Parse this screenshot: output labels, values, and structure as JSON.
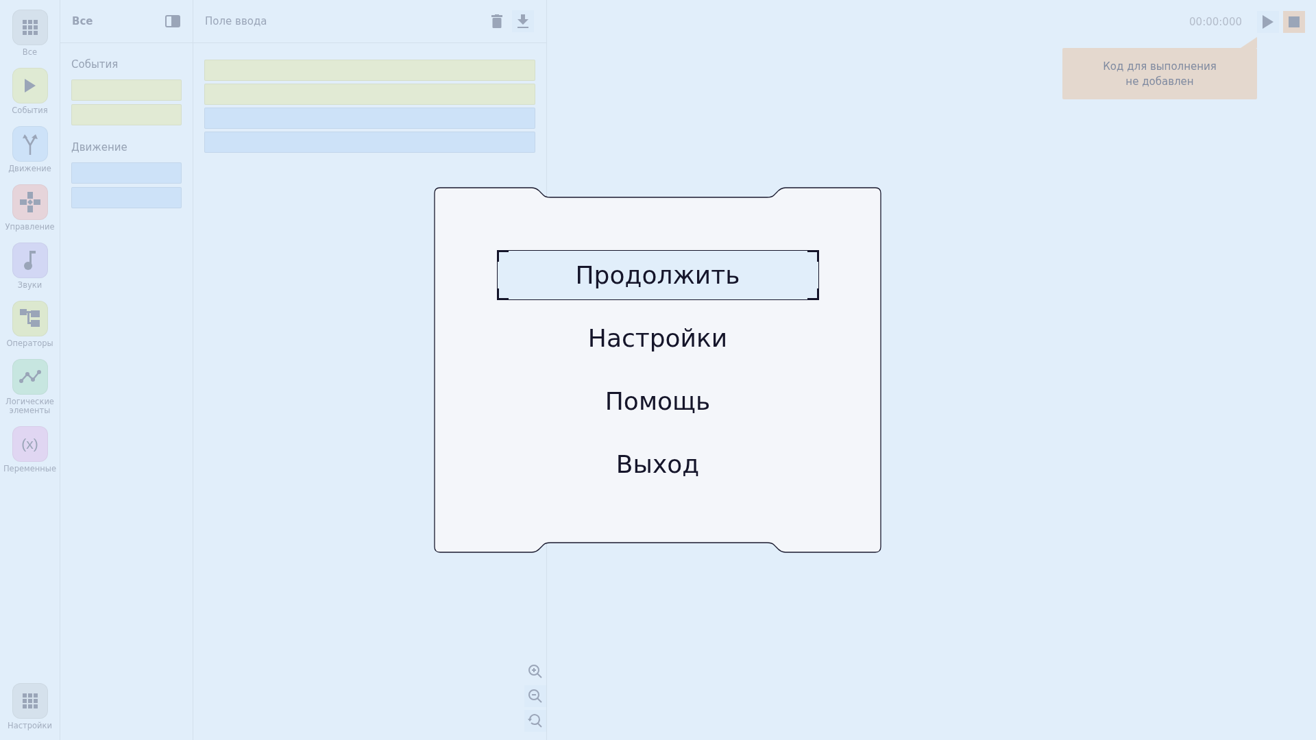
{
  "rail": {
    "items": [
      {
        "label": "Все",
        "color": "#d5e1ec"
      },
      {
        "label": "События",
        "color": "#dfead3"
      },
      {
        "label": "Движение",
        "color": "#cde2f8"
      },
      {
        "label": "Управление",
        "color": "#e6d4da"
      },
      {
        "label": "Звуки",
        "color": "#d2d7f4"
      },
      {
        "label": "Операторы",
        "color": "#dce8cf"
      },
      {
        "label": "Логические элементы",
        "color": "#c7e6e0"
      },
      {
        "label": "Переменные",
        "glyph": "(x)",
        "color": "#e0d6f2"
      }
    ],
    "bottom": {
      "label": "Настройки",
      "color": "#d5e1ec"
    }
  },
  "palette": {
    "title": "Все",
    "sections": [
      {
        "title": "События",
        "blocks": [
          {
            "color": "#e1ead4"
          },
          {
            "color": "#e1ead4"
          }
        ]
      },
      {
        "title": "Движение",
        "blocks": [
          {
            "color": "#cde2f8"
          },
          {
            "color": "#cde2f8"
          }
        ]
      }
    ]
  },
  "workspace": {
    "title": "Поле ввода",
    "blocks": [
      {
        "color": "#e1ead4"
      },
      {
        "color": "#e1ead4"
      },
      {
        "color": "#cde2f8"
      },
      {
        "color": "#cde2f8"
      }
    ]
  },
  "run": {
    "time": "00:00:000",
    "message": "Код для выполнения\nне добавлен"
  },
  "menu": {
    "items": [
      {
        "label": "Продолжить",
        "selected": true
      },
      {
        "label": "Настройки",
        "selected": false
      },
      {
        "label": "Помощь",
        "selected": false
      },
      {
        "label": "Выход",
        "selected": false
      }
    ]
  }
}
